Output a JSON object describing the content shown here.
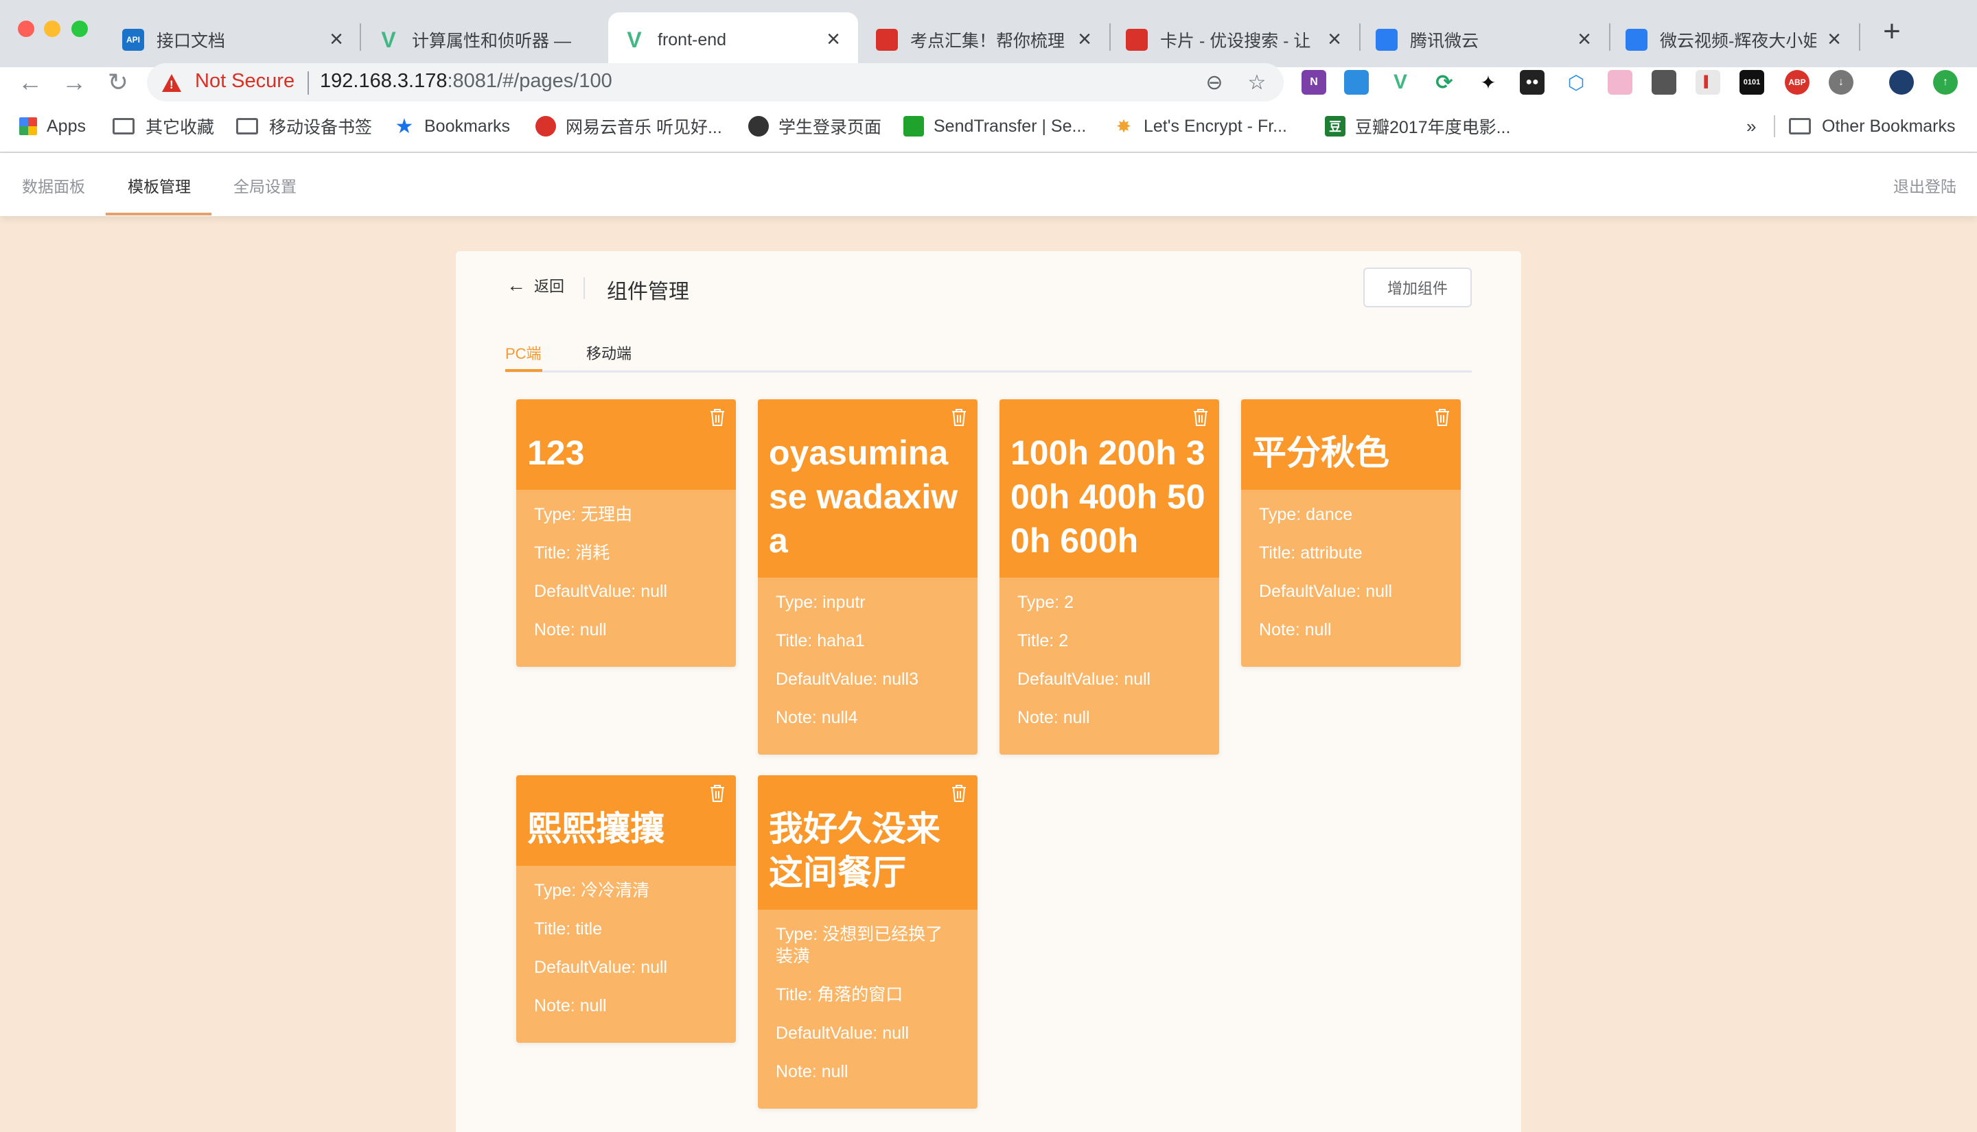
{
  "browser": {
    "tabs": [
      {
        "title": "接口文档",
        "favicon": "API",
        "favicon_color": "#1a73c8"
      },
      {
        "title": "计算属性和侦听器 —",
        "favicon": "V",
        "favicon_color": "#41b883"
      },
      {
        "title": "front-end",
        "favicon": "V",
        "favicon_color": "#41b883"
      },
      {
        "title": "考点汇集！帮你梳理",
        "favicon": "",
        "favicon_color": "#d9322b"
      },
      {
        "title": "卡片 - 优设搜索 - 让",
        "favicon": "",
        "favicon_color": "#d9322b"
      },
      {
        "title": "腾讯微云",
        "favicon": "",
        "favicon_color": "#2a7ef2"
      },
      {
        "title": "微云视频-辉夜大小姐",
        "favicon": "",
        "favicon_color": "#2a7ef2"
      }
    ],
    "security_label": "Not Secure",
    "url_host": "192.168.3.178",
    "url_rest": ":8081/#/pages/100",
    "bookmarks": [
      {
        "label": "Apps",
        "icon": "apps-grid-icon"
      },
      {
        "label": "其它收藏",
        "icon": "folder-icon"
      },
      {
        "label": "移动设备书签",
        "icon": "folder-icon"
      },
      {
        "label": "Bookmarks",
        "icon": "star-icon"
      },
      {
        "label": "网易云音乐 听见好...",
        "icon": "netease-music-icon"
      },
      {
        "label": "学生登录页面",
        "icon": "globe-icon"
      },
      {
        "label": "SendTransfer | Se...",
        "icon": "sendtransfer-icon"
      },
      {
        "label": "Let's Encrypt - Fr...",
        "icon": "letsencrypt-icon"
      },
      {
        "label": "豆瓣2017年度电影...",
        "icon": "douban-icon"
      }
    ],
    "bookmarks_overflow": "»",
    "other_bookmarks": "Other Bookmarks"
  },
  "app": {
    "nav": [
      "数据面板",
      "模板管理",
      "全局设置"
    ],
    "active_nav": 1,
    "logout": "退出登陆",
    "back_label": "返回",
    "page_title": "组件管理",
    "add_button": "增加组件",
    "sub_tabs": [
      "PC端",
      "移动端"
    ],
    "active_sub_tab": 0
  },
  "cards": [
    {
      "name": "123",
      "type": "Type: 无理由",
      "title": "Title: 消耗",
      "default": "DefaultValue: null",
      "note": "Note: null"
    },
    {
      "name": "oyasuminase wadaxiwa",
      "type": "Type: inputr",
      "title": "Title: haha1",
      "default": "DefaultValue: null3",
      "note": "Note: null4"
    },
    {
      "name": "100h 200h 300h 400h 500h 600h",
      "type": "Type: 2",
      "title": "Title: 2",
      "default": "DefaultValue: null",
      "note": "Note: null"
    },
    {
      "name": "平分秋色",
      "type": "Type: dance",
      "title": "Title: attribute",
      "default": "DefaultValue: null",
      "note": "Note: null"
    },
    {
      "name": "熙熙攘攘",
      "type": "Type: 冷冷清清",
      "title": "Title: title",
      "default": "DefaultValue: null",
      "note": "Note: null"
    },
    {
      "name": "我好久没来这间餐厅",
      "type": "Type: 没想到已经换了装潢",
      "title": "Title: 角落的窗口",
      "default": "DefaultValue: null",
      "note": "Note: null"
    }
  ],
  "colors": {
    "page_bg": "#f9e6d4",
    "card_head": "#fa982b",
    "card_body": "#fbb566",
    "accent": "#f59a33"
  }
}
